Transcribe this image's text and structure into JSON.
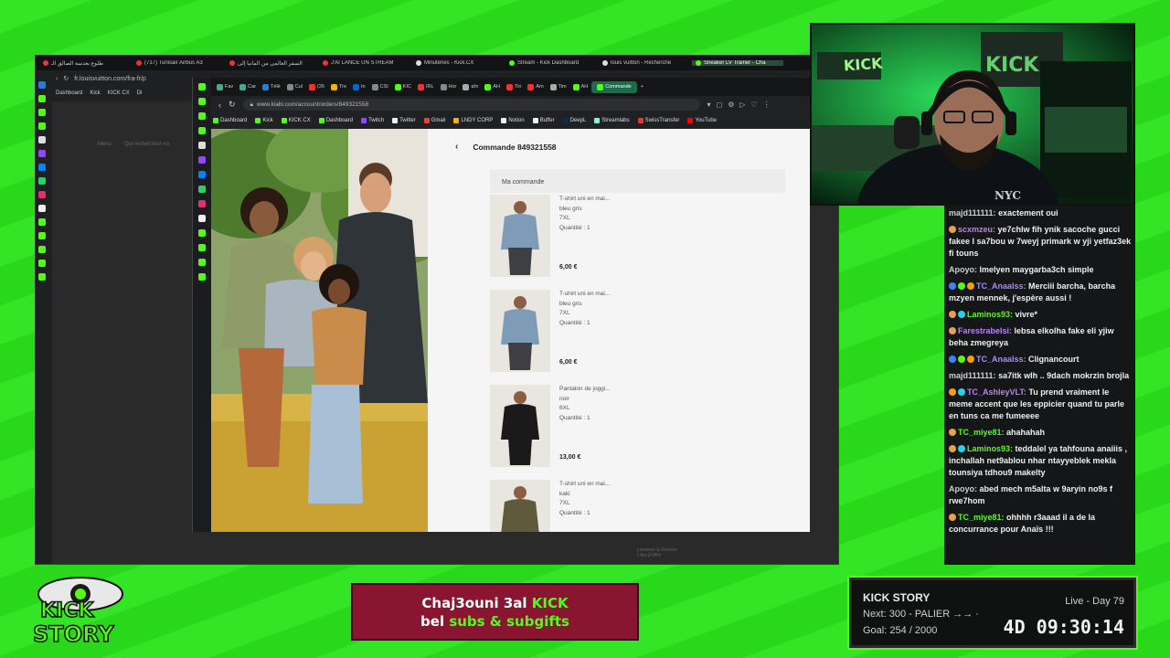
{
  "back_browser": {
    "tabs": [
      {
        "label": "طلوع بعدسة الصالق الـ",
        "color": "#e33"
      },
      {
        "label": "(717) Tunisair Airbus A3",
        "color": "#e33"
      },
      {
        "label": "السفر العالمي من المانيا إلى",
        "color": "#e33"
      },
      {
        "label": "J'AI LANCÉ UN STREAM",
        "color": "#e33"
      },
      {
        "label": "Minuteries - Kick.CX",
        "color": "#ddd"
      },
      {
        "label": "Stream - Kick Dashboard",
        "color": "#53fc18"
      },
      {
        "label": "louis vuitton - Recherche",
        "color": "#ddd"
      },
      {
        "label": "Sneaker LV Trainer - Cha",
        "color": "#53fc18"
      }
    ],
    "url": "fr.louisvuitton.com/fra-fr/p",
    "bookmarks": [
      "Dashboard",
      "Kick",
      "KICK CX",
      "Di"
    ],
    "menu_label": "Menu",
    "search_label": "Qui recherchez-vo",
    "footer_links": [
      "Livraison & Retours",
      "L'Art d'Offrir"
    ]
  },
  "front_browser": {
    "tabs": [
      {
        "label": "Fav",
        "color": "#4a8"
      },
      {
        "label": "Car",
        "color": "#4a8"
      },
      {
        "label": "Télé",
        "color": "#2b7bd8"
      },
      {
        "label": "Cul",
        "color": "#888"
      },
      {
        "label": "(26",
        "color": "#e33"
      },
      {
        "label": "Tre",
        "color": "#f0b400"
      },
      {
        "label": "In",
        "color": "#0a66c2"
      },
      {
        "label": "CSI",
        "color": "#888"
      },
      {
        "label": "KIC",
        "color": "#53fc18"
      },
      {
        "label": "IRL",
        "color": "#e33"
      },
      {
        "label": "Hor",
        "color": "#888"
      },
      {
        "label": "ahr",
        "color": "#aaa"
      },
      {
        "label": "AH",
        "color": "#53fc18"
      },
      {
        "label": "Tin",
        "color": "#e33"
      },
      {
        "label": "Am",
        "color": "#e33"
      },
      {
        "label": "Tim",
        "color": "#aaa"
      },
      {
        "label": "AH",
        "color": "#53fc18"
      }
    ],
    "active_tab": "Commande",
    "url": "www.kiabi.com/account/orders/849321558",
    "bookmarks": [
      {
        "label": "Dashboard",
        "color": "#53fc18"
      },
      {
        "label": "Kick",
        "color": "#53fc18"
      },
      {
        "label": "KICK CX",
        "color": "#53fc18"
      },
      {
        "label": "Dashboard",
        "color": "#53fc18"
      },
      {
        "label": "Twitch",
        "color": "#9146ff"
      },
      {
        "label": "Twitter",
        "color": "#eee"
      },
      {
        "label": "Gmail",
        "color": "#ea4335"
      },
      {
        "label": "LNDY CORP",
        "color": "#f0b400"
      },
      {
        "label": "Notion",
        "color": "#eee"
      },
      {
        "label": "Buffer",
        "color": "#eee"
      },
      {
        "label": "DeepL",
        "color": "#0f2b46"
      },
      {
        "label": "Streamlabs",
        "color": "#80f5d2"
      },
      {
        "label": "SwissTransfer",
        "color": "#e33"
      },
      {
        "label": "YouTube",
        "color": "#ff0000"
      }
    ]
  },
  "order": {
    "title": "Commande 849321558",
    "section": "Ma commande",
    "items": [
      {
        "name": "T-shirt uni en mai...",
        "color": "bleu gris",
        "size": "7XL",
        "qty": "Quantité : 1",
        "price": "6,00 €",
        "shirt": "#7e9bb8",
        "pants": "#3d3f42"
      },
      {
        "name": "T-shirt uni en mai...",
        "color": "bleu gris",
        "size": "7XL",
        "qty": "Quantité : 1",
        "price": "6,00 €",
        "shirt": "#7e9bb8",
        "pants": "#3d3f42"
      },
      {
        "name": "Pantalon de joggi...",
        "color": "noir",
        "size": "6XL",
        "qty": "Quantité : 1",
        "price": "13,00 €",
        "shirt": "#1a1a1a",
        "pants": "#1a1a1a"
      },
      {
        "name": "T-shirt uni en mai...",
        "color": "kaki",
        "size": "7XL",
        "qty": "Quantité : 1",
        "price": "",
        "shirt": "#5f5a3c",
        "pants": "#3d3f42"
      }
    ]
  },
  "chat": [
    {
      "user": "majd111111:",
      "text": " exactement oui",
      "color": "#cfcfcf",
      "badges": []
    },
    {
      "user": "scxmzeu:",
      "text": " ye7chlw fih ynik sacoche gucci fakee l sa7bou w 7weyj primark w yji yetfaz3ek fi touns",
      "color": "#b784f5",
      "badges": [
        "#e8a04a"
      ]
    },
    {
      "user": "Apoyo:",
      "text": " lmelyen maygarba3ch simple",
      "color": "#cfcfcf",
      "badges": []
    },
    {
      "user": "TC_Anaalss:",
      "text": " Merciii barcha, barcha mzyen mennek, j'espère aussi !",
      "color": "#a78bfa",
      "badges": [
        "#3b82f6",
        "#53fc18",
        "#f59e0b"
      ]
    },
    {
      "user": "Laminos93:",
      "text": " vivre*",
      "color": "#53fc18",
      "badges": [
        "#e8a04a",
        "#22d3ee"
      ]
    },
    {
      "user": "Farestrabelsi:",
      "text": " lebsa elkolha fake eli yjiw beha zmegreya",
      "color": "#b784f5",
      "badges": [
        "#e8a04a"
      ]
    },
    {
      "user": "TC_Anaalss:",
      "text": " Clignancourt",
      "color": "#a78bfa",
      "badges": [
        "#3b82f6",
        "#53fc18",
        "#f59e0b"
      ]
    },
    {
      "user": "majd111111:",
      "text": " sa7itk wlh .. 9dach mokrzin brojla",
      "color": "#cfcfcf",
      "badges": []
    },
    {
      "user": "TC_AshleyVLT:",
      "text": " Tu prend vraiment le meme accent que les eppicier quand tu parle en tuns ca me fumeeee",
      "color": "#b784f5",
      "badges": [
        "#f59e0b",
        "#22d3ee"
      ]
    },
    {
      "user": "TC_miye81:",
      "text": " ahahahah",
      "color": "#53fc18",
      "badges": [
        "#e8a04a"
      ]
    },
    {
      "user": "Laminos93:",
      "text": " teddalel ya tahfouna anaiiis , inchallah net9ablou nhar ntayyeblek mekla tounsiya tdhou9 makelty",
      "color": "#53fc18",
      "badges": [
        "#e8a04a",
        "#22d3ee"
      ]
    },
    {
      "user": "Apoyo:",
      "text": " abed mech m5alta w 9aryin no9s f rwe7hom",
      "color": "#cfcfcf",
      "badges": []
    },
    {
      "user": "TC_miye81:",
      "text": " ohhhh r3aaad il a de la concurrance pour Anaïs !!!",
      "color": "#53fc18",
      "badges": [
        "#e8a04a"
      ]
    }
  ],
  "overlay": {
    "logo_line1": "KICK",
    "logo_line2": "STORY",
    "banner_line1_a": "Chaj3ouni 3al ",
    "banner_line1_b": "KICK",
    "banner_line2_a": "bel ",
    "banner_line2_b": "subs & subgifts",
    "story_title": "KICK STORY",
    "story_next": "Next: 300 - PALIER →→ ·",
    "story_goal": "Goal: 254 / 2000",
    "story_live": "Live - Day 79",
    "story_timer": "4D 09:30:14"
  },
  "webcam": {
    "sign": "KICK",
    "shirt_text": "NYC"
  }
}
